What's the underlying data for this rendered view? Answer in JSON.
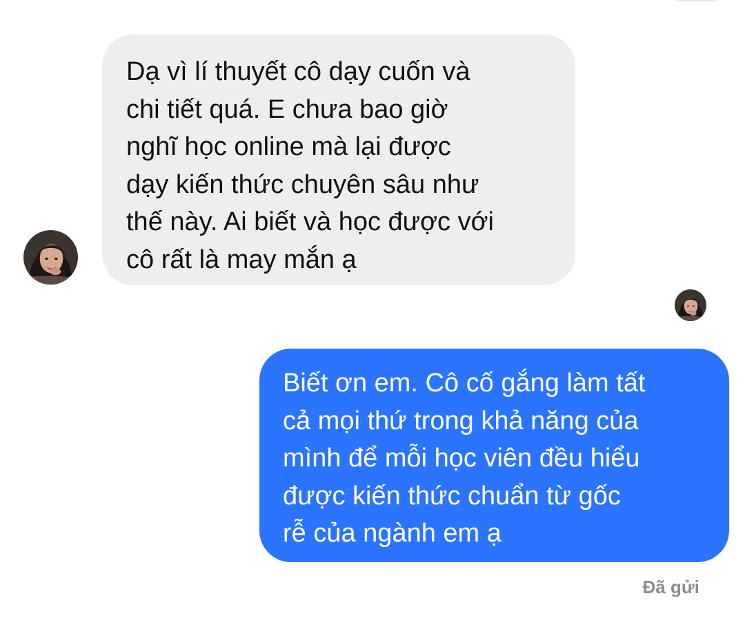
{
  "thread": {
    "incoming_message": {
      "text": "Dạ vì lí thuyết cô dạy cuốn và\nchi tiết quá. E chưa bao giờ\nnghĩ học online mà lại được\ndạy kiến thức chuyên sâu như\nthế này. Ai biết và học được với\ncô rất là may mắn ạ"
    },
    "outgoing_message": {
      "text": "Biết ơn em. Cô cố gắng làm tất\ncả mọi thứ trong khả năng của\nmình để mỗi học viên đều hiểu\nđược kiến thức chuẩn từ gốc\nrễ của ngành em ạ"
    },
    "delivery_status": "Đã gửi"
  },
  "colors": {
    "incoming_bubble": "#eeeeee",
    "outgoing_bubble": "#2b74ff",
    "status_text": "#8e8e8e"
  },
  "icons": {
    "sender_avatar": "profile-photo-avatar",
    "seen_avatar": "profile-photo-avatar"
  }
}
